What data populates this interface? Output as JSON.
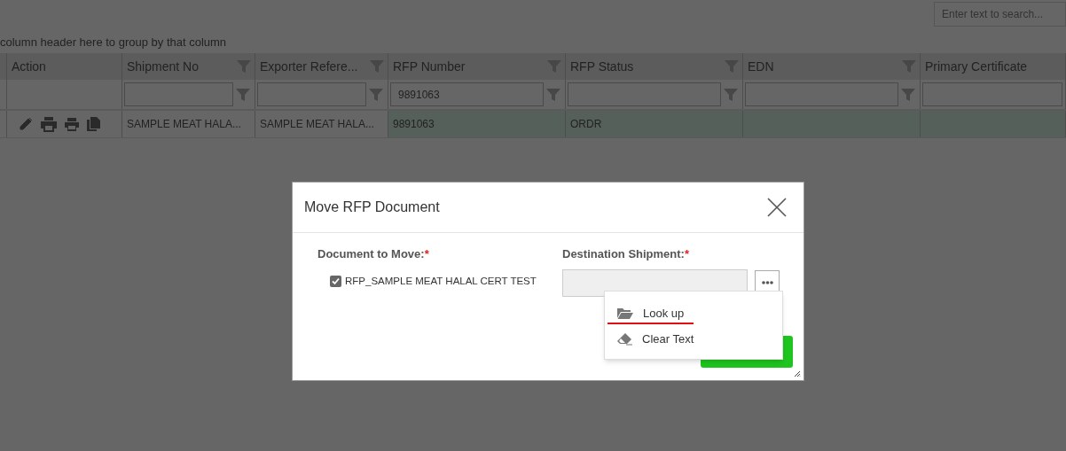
{
  "search": {
    "placeholder": "Enter text to search..."
  },
  "group_panel": {
    "text": "column header here to group by that column"
  },
  "grid": {
    "columns": [
      {
        "label": "Action",
        "kind": "action"
      },
      {
        "label": "Shipment No",
        "kind": "filter"
      },
      {
        "label": "Exporter Refere...",
        "kind": "filter"
      },
      {
        "label": "RFP Number",
        "kind": "filter",
        "filter_value": "9891063"
      },
      {
        "label": "RFP Status",
        "kind": "filter"
      },
      {
        "label": "EDN",
        "kind": "filter"
      },
      {
        "label": "Primary Certificate",
        "kind": "edge"
      }
    ],
    "rows": [
      {
        "selected": true,
        "cells": [
          "",
          "SAMPLE MEAT HALA...",
          "SAMPLE MEAT HALA...",
          "9891063",
          "ORDR",
          "",
          ""
        ]
      }
    ]
  },
  "dialog": {
    "title": "Move RFP Document",
    "document_label": "Document to Move:",
    "document_mark": "*",
    "documents": [
      {
        "label": "RFP_SAMPLE MEAT HALAL CERT TEST",
        "checked": true
      }
    ],
    "destination_label": "Destination Shipment:",
    "destination_mark": "*",
    "menu": [
      {
        "kind": "folder",
        "label": "Look up",
        "underlined": true
      },
      {
        "kind": "eraser",
        "label": "Clear Text",
        "underlined": false
      }
    ]
  }
}
